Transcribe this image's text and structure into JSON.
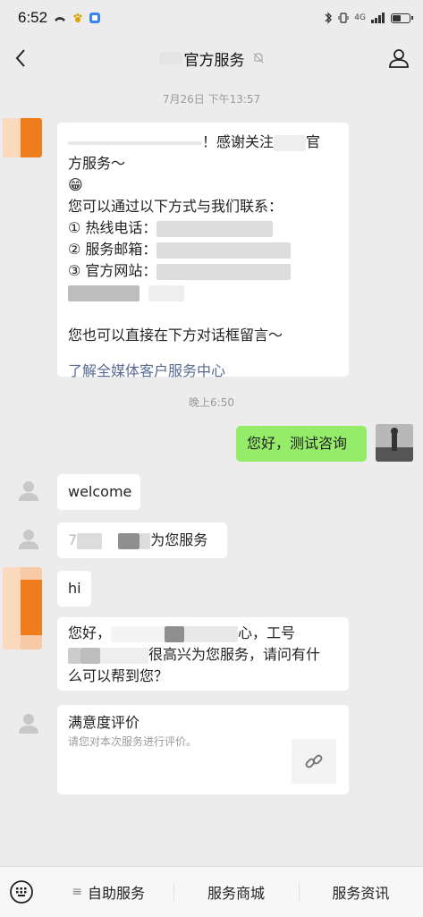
{
  "status_bar": {
    "time": "6:52",
    "left_icons": [
      "missed-call-icon",
      "paw-icon",
      "app-icon"
    ],
    "right_icons": [
      "bluetooth-icon",
      "vibrate-icon",
      "signal-icon",
      "battery-icon"
    ],
    "network_label": "4G"
  },
  "header": {
    "title": "官方服务"
  },
  "messages": {
    "ts1": "7月26日 下午13:57",
    "welcome": {
      "line1_tail": "！感谢关注",
      "line1_end": "官",
      "line2": "方服务～",
      "emoji": "😁",
      "contact_intro": "您可以通过以下方式与我们联系：",
      "hotline": "① 热线电话：",
      "email": "② 服务邮箱：",
      "website": "③ 官方网站：",
      "leave_message": "您也可以直接在下方对话框留言～",
      "link": "了解全媒体客户服务中心"
    },
    "ts2": "晚上6:50",
    "user_msg": "您好，测试咨询",
    "agent_welcome": "welcome",
    "agent_service_prefix": "7",
    "agent_service": "为您服务",
    "brand_hi": "hi",
    "greeting_line1a": "您好，",
    "greeting_line1b": "心，工号",
    "greeting_line2": "很高兴为您服务，请问有什",
    "greeting_line3": "么可以帮到您？",
    "rating_title": "满意度评价",
    "rating_sub": "请您对本次服务进行评价。"
  },
  "bottom_menu": {
    "item1": "自助服务",
    "item2": "服务商城",
    "item3": "服务资讯"
  },
  "colors": {
    "chat_bg": "#ececec",
    "bubble_green": "#95ec69",
    "link": "#576b95",
    "brand_orange": "#f07d1c"
  }
}
